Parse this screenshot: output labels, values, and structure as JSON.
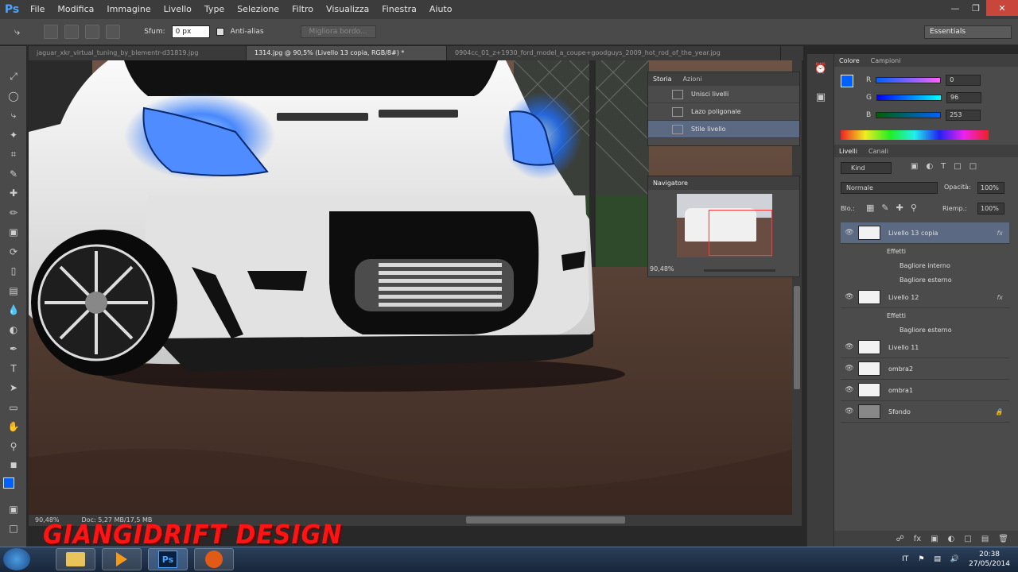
{
  "app": {
    "logo": "Ps"
  },
  "menu": [
    "File",
    "Modifica",
    "Immagine",
    "Livello",
    "Type",
    "Selezione",
    "Filtro",
    "Visualizza",
    "Finestra",
    "Aiuto"
  ],
  "options": {
    "feather_label": "Sfum:",
    "feather_value": "0 px",
    "antialias_label": "Anti-alias",
    "refine_label": "Migliora bordo...",
    "workspace": "Essentials"
  },
  "doc_tabs": [
    "jaguar_xkr_virtual_tuning_by_blementr-d31819.jpg",
    "1314.jpg @ 90,5% (Livello 13 copia, RGB/8#) *",
    "0904cc_01_z+1930_ford_model_a_coupe+goodguys_2009_hot_rod_of_the_year.jpg"
  ],
  "status": {
    "zoom": "90,48%",
    "doc": "Doc: 5,27 MB/17,5 MB"
  },
  "history_panel": {
    "tabs": [
      "Storia",
      "Azioni"
    ],
    "rows": [
      "Unisci livelli",
      "Lazo poligonale",
      "Stile livello"
    ]
  },
  "navigator": {
    "title": "Navigatore",
    "zoom": "90,48%"
  },
  "color_panel": {
    "tabs": [
      "Colore",
      "Campioni"
    ],
    "R": "0",
    "G": "96",
    "B": "253",
    "labels": [
      "R",
      "G",
      "B"
    ]
  },
  "layers_panel": {
    "tabs": [
      "Livelli",
      "Canali"
    ],
    "kind": "Kind",
    "blend": "Normale",
    "opacity_label": "Opacità:",
    "opacity": "100%",
    "lock_label": "Blo.:",
    "fill_label": "Riemp.:",
    "fill": "100%",
    "layers": [
      {
        "name": "Livello 13 copia",
        "fx": "fx",
        "selected": true
      },
      {
        "name": "Livello 12",
        "fx": "fx"
      },
      {
        "name": "Livello 11",
        "fx": ""
      },
      {
        "name": "ombra2",
        "fx": ""
      },
      {
        "name": "ombra1",
        "fx": ""
      },
      {
        "name": "Sfondo",
        "fx": ""
      }
    ],
    "effects_label": "Effetti",
    "fx_items_13": [
      "Bagliore interno",
      "Bagliore esterno"
    ],
    "fx_items_12": [
      "Bagliore esterno"
    ]
  },
  "watermark": "GIANGIDRIFT DESIGN",
  "tray": {
    "lang": "IT",
    "time": "20:38",
    "date": "27/05/2014"
  },
  "colors": {
    "accent": "#0060fd",
    "watermark": "#ff1414",
    "menubar": "#3c3c3c"
  }
}
